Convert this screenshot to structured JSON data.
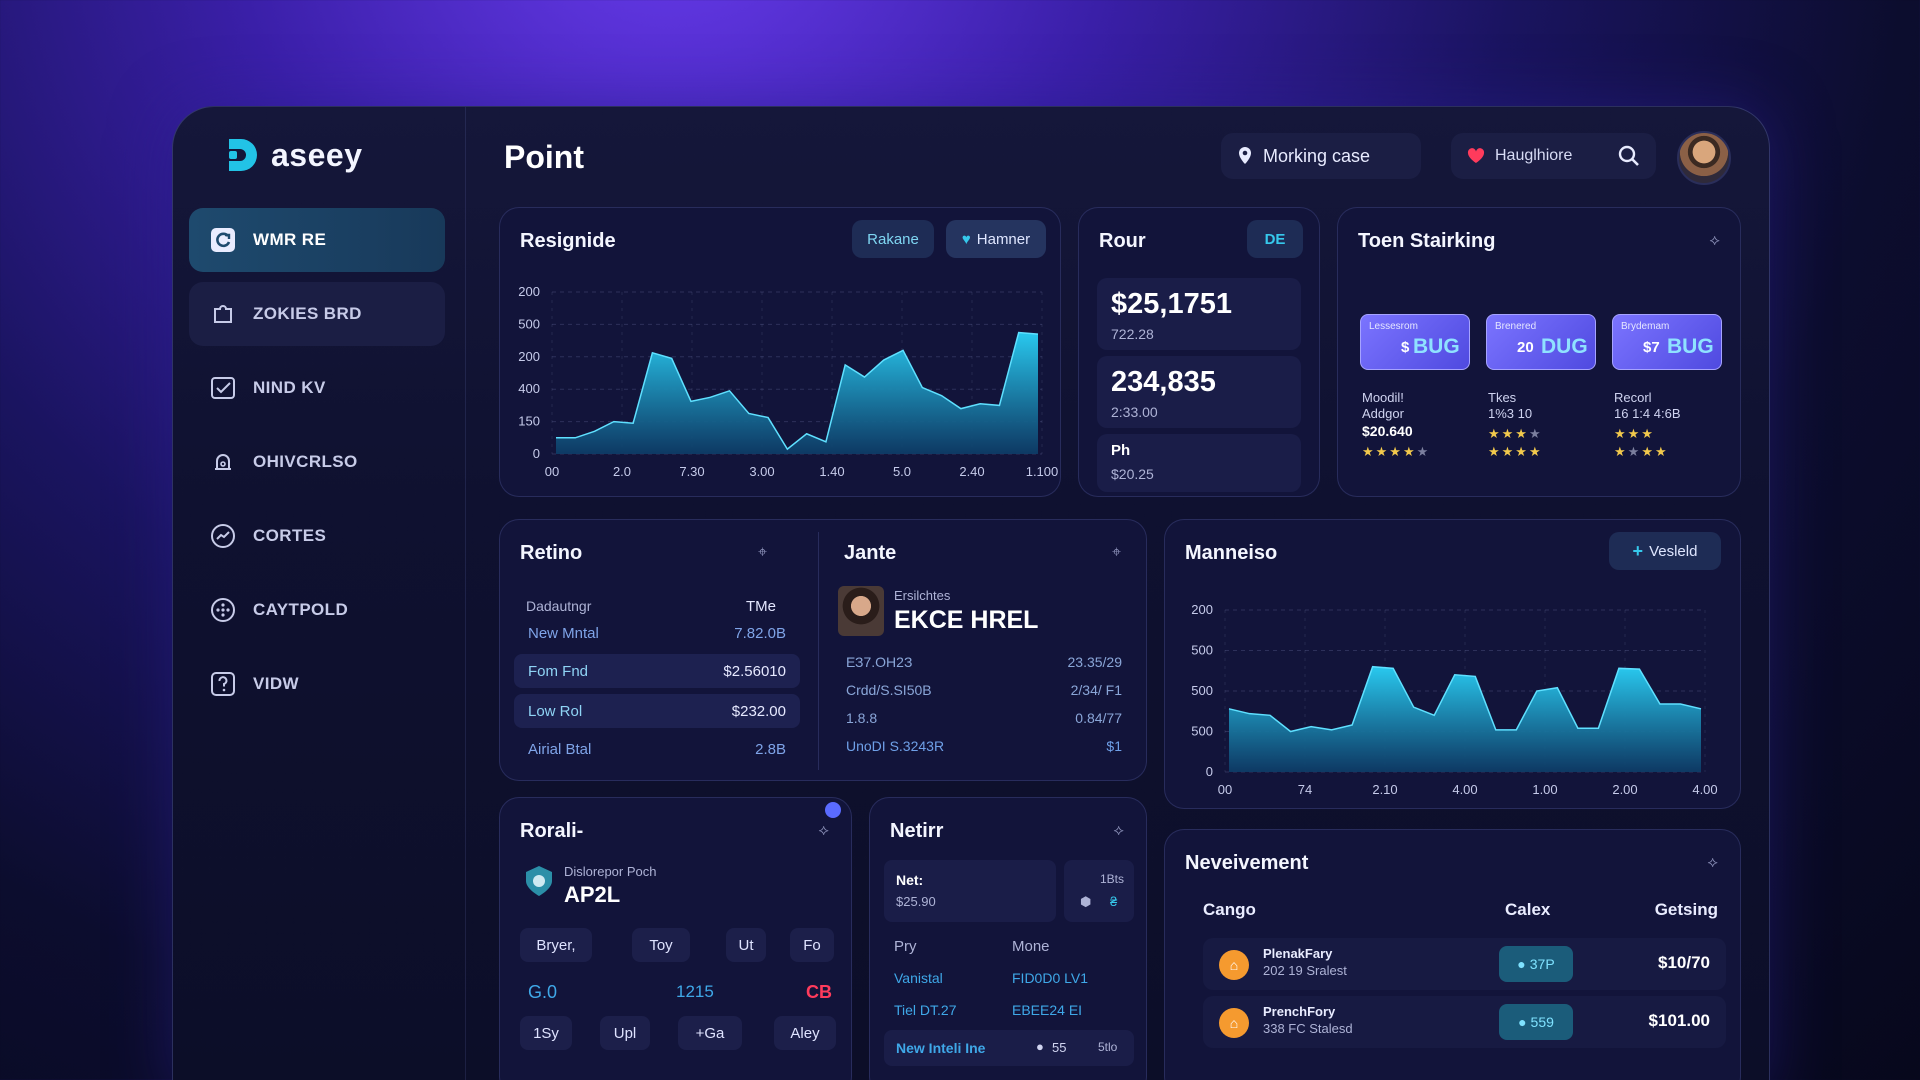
{
  "brand": {
    "name": "aseey",
    "accent": "#22c3e6"
  },
  "sidebar": {
    "items": [
      {
        "label": "WMR RE",
        "icon": "refresh-square-icon"
      },
      {
        "label": "ZOKIES BRD",
        "icon": "puzzle-icon"
      },
      {
        "label": "NIND KV",
        "icon": "checkbox-icon"
      },
      {
        "label": "OHIVCRLSO",
        "icon": "bell-icon"
      },
      {
        "label": "CORTES",
        "icon": "chart-circle-icon"
      },
      {
        "label": "CAYTPOLD",
        "icon": "dots-circle-icon"
      },
      {
        "label": "VIDW",
        "icon": "help-square-icon"
      }
    ]
  },
  "header": {
    "title": "Point",
    "location_label": "Morking case",
    "favorite_label": "Hauglhiore"
  },
  "resignide": {
    "title": "Resignide",
    "btn_secondary": "Rakane",
    "btn_primary": "Hamner",
    "y_ticks": [
      "200",
      "500",
      "200",
      "400",
      "150",
      "0"
    ],
    "x_ticks": [
      "00",
      "2.0",
      "7.30",
      "3.00",
      "1.40",
      "5.0",
      "2.40",
      "1.100"
    ]
  },
  "rour": {
    "title": "Rour",
    "badge": "DE",
    "stat1_value": "$25,1751",
    "stat1_sub": "722.28",
    "stat2_value": "234,835",
    "stat2_sub": "2:33.00",
    "stat3_label": "Ph",
    "stat3_sub": "$20.25"
  },
  "toen": {
    "title": "Toen Stairking",
    "badges": [
      {
        "top": "Lessesrom",
        "bottom": "BUG",
        "prefix": "$"
      },
      {
        "top": "Brenered",
        "bottom": "DUG",
        "prefix": "20"
      },
      {
        "top": "Brydemam",
        "bottom": "BUG",
        "prefix": "$7"
      }
    ],
    "items": [
      {
        "l1": "Moodil!",
        "l2": "Addgor",
        "l3": "$20.640",
        "rating": 4
      },
      {
        "l1": "Tkes",
        "l2": "1%3 10",
        "l3": "",
        "rating": 3
      },
      {
        "l1": "Recorl",
        "l2": "16 1:4 4:6B",
        "l3": "",
        "rating": 3
      }
    ]
  },
  "retino": {
    "title": "Retino",
    "header_left": "Dadautngr",
    "header_right": "TMe",
    "rows": [
      {
        "label": "New Mntal",
        "value": "7.82.0B",
        "hl": false
      },
      {
        "label": "Fom Fnd",
        "value": "$2.56010",
        "hl": true
      },
      {
        "label": "Low Rol",
        "value": "$232.00",
        "hl": true
      },
      {
        "label": "Airial Btal",
        "value": "2.8B",
        "hl": false
      }
    ]
  },
  "jante": {
    "title": "Jante",
    "profile_sub": "Ersilchtes",
    "profile_name": "EKCE HREL",
    "rows": [
      {
        "label": "ЕЗ7.ОН2З",
        "value": "23.35/29"
      },
      {
        "label": "Crdd/S.SI50B",
        "value": "2/34/ F1"
      },
      {
        "label": "1.8.8",
        "value": "0.84/77"
      },
      {
        "label": "UnoDI S.3243R",
        "value": "$1"
      }
    ]
  },
  "manneiso": {
    "title": "Manneiso",
    "action_label": "Vesleld",
    "y_ticks": [
      "200",
      "500",
      "500",
      "500",
      "0"
    ],
    "x_ticks": [
      "00",
      "74",
      "2.10",
      "4.00",
      "1.00",
      "2.00",
      "4.00"
    ]
  },
  "rorali": {
    "title": "Rorali-",
    "sub": "Dislorepor Poch",
    "name": "AP2L",
    "tabs": [
      "Bryer,",
      "Toy",
      "Ut",
      "Fo"
    ],
    "values": [
      "G.0",
      "1215",
      "CB"
    ],
    "chips": [
      "1Sy",
      "Upl",
      "+Ga",
      "Aley"
    ]
  },
  "netirr": {
    "title": "Netirr",
    "net_label": "Net:",
    "net_value": "$25.90",
    "side_label": "1Bts",
    "col1": "Pry",
    "col2": "Mone",
    "rows": [
      {
        "label": "Vanistal",
        "value": "FID0D0 LV1"
      },
      {
        "label": "Tiel DT.27",
        "value": "EBEE24 EI"
      }
    ],
    "footer_label": "New Inteli Ine",
    "footer_value": "55",
    "footer_extra": "5tlo"
  },
  "neveivement": {
    "title": "Neveivement",
    "cols": [
      "Cango",
      "Calex",
      "Getsing"
    ],
    "rows": [
      {
        "name": "PlenakFary",
        "sub": "202 19 Sralest",
        "tag": "37P",
        "amount": "$10/70"
      },
      {
        "name": "PrenchFory",
        "sub": "338 FC Stalesd",
        "tag": "559",
        "amount": "$101.00"
      }
    ]
  },
  "chart_data": [
    {
      "type": "area",
      "title": "Resignide",
      "x": [
        "00",
        "2.0",
        "7.30",
        "3.00",
        "1.40",
        "5.0",
        "2.40",
        "1.100"
      ],
      "series": [
        {
          "values": [
            20,
            20,
            28,
            40,
            38,
            125,
            118,
            65,
            70,
            78,
            50,
            45,
            6,
            25,
            15,
            110,
            95,
            116,
            128,
            82,
            72,
            56,
            62,
            60,
            150,
            148
          ]
        }
      ],
      "ylim": [
        0,
        200
      ]
    },
    {
      "type": "area",
      "title": "Manneiso",
      "x": [
        "00",
        "74",
        "2.10",
        "4.00",
        "1.00",
        "2.00",
        "4.00"
      ],
      "series": [
        {
          "values": [
            78,
            72,
            70,
            50,
            56,
            52,
            58,
            130,
            128,
            80,
            70,
            120,
            118,
            52,
            52,
            100,
            104,
            54,
            54,
            128,
            127,
            84,
            84,
            78
          ]
        }
      ],
      "ylim": [
        0,
        200
      ]
    }
  ]
}
